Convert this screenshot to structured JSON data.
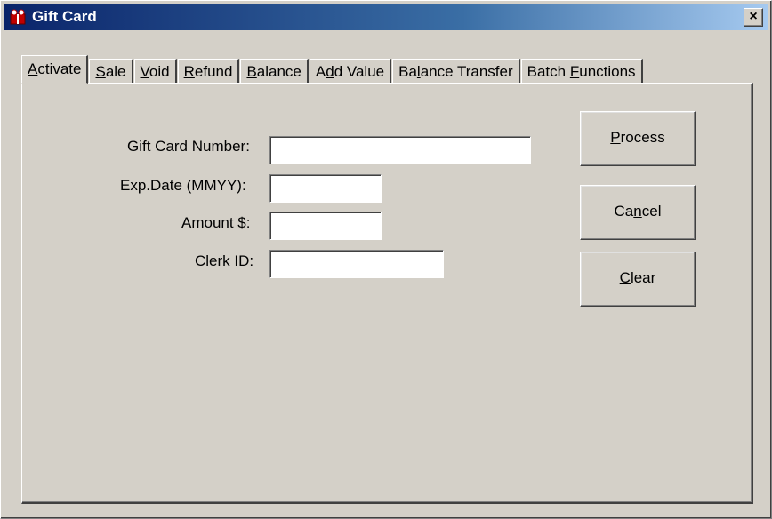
{
  "window": {
    "title": "Gift Card",
    "close_label": "×"
  },
  "tabs": [
    {
      "pre": "",
      "key": "A",
      "post": "ctivate",
      "active": true
    },
    {
      "pre": "",
      "key": "S",
      "post": "ale"
    },
    {
      "pre": "",
      "key": "V",
      "post": "oid"
    },
    {
      "pre": "",
      "key": "R",
      "post": "efund"
    },
    {
      "pre": "",
      "key": "B",
      "post": "alance"
    },
    {
      "pre": "A",
      "key": "d",
      "post": "d Value"
    },
    {
      "pre": "Ba",
      "key": "l",
      "post": "ance Transfer"
    },
    {
      "pre": "Batch ",
      "key": "F",
      "post": "unctions"
    }
  ],
  "form": {
    "card_number_label": "Gift Card Number:",
    "card_number_value": "",
    "exp_date_label": "Exp.Date (MMYY):",
    "exp_date_value": "",
    "amount_label": "Amount $:",
    "amount_value": "",
    "clerk_id_label": "Clerk ID:",
    "clerk_id_value": ""
  },
  "buttons": {
    "process": {
      "pre": "",
      "key": "P",
      "post": "rocess"
    },
    "cancel": {
      "pre": "Ca",
      "key": "n",
      "post": "cel"
    },
    "clear": {
      "pre": "",
      "key": "C",
      "post": "lear"
    }
  }
}
